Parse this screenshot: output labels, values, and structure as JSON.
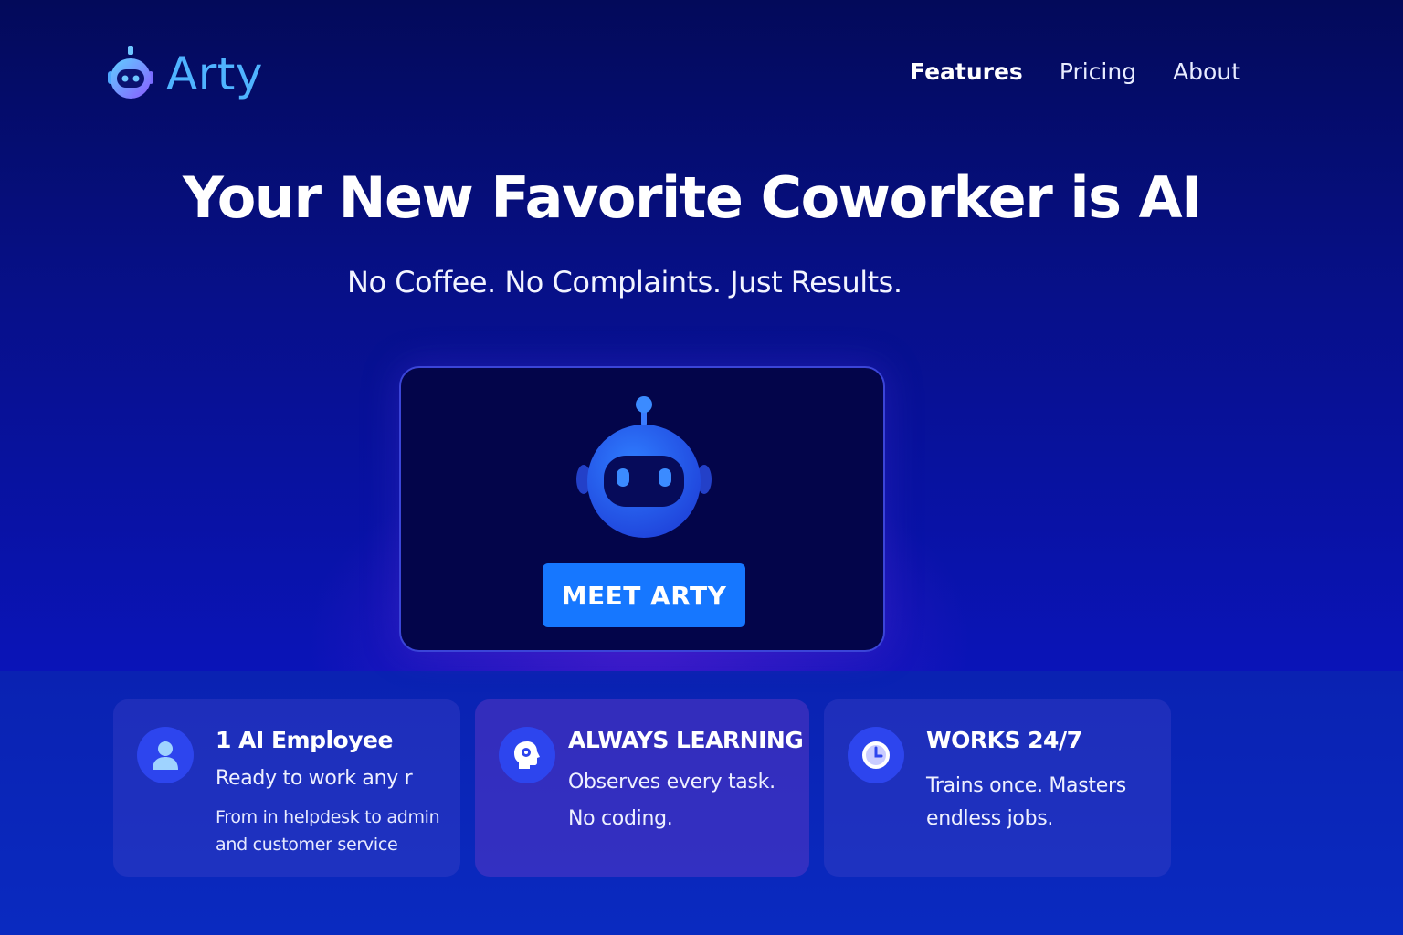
{
  "brand": {
    "name": "Arty",
    "icon": "robot-head-icon",
    "color": "#4fb3ff"
  },
  "nav": {
    "items": [
      {
        "label": "Features",
        "active": true
      },
      {
        "label": "Pricing",
        "active": false
      },
      {
        "label": "About",
        "active": false
      }
    ]
  },
  "hero": {
    "headline": "Your New Favorite Coworker is AI",
    "subheadline": "No Coffee. No Complaints. Just Results.",
    "card_icon": "robot-mascot-icon",
    "cta_label": "MEET ARTY",
    "cta_color": "#1677ff"
  },
  "features": [
    {
      "icon": "user-icon",
      "title": "1 AI Employee",
      "line1": "Ready to work any r",
      "line2": "From in helpdesk to admin",
      "line3": "and customer service"
    },
    {
      "icon": "brain-head-icon",
      "title": "ALWAYS LEARNING",
      "line1": "Observes every task.",
      "line2": "No coding."
    },
    {
      "icon": "clock-icon",
      "title": "WORKS 24/7",
      "line1": "Trains once. Masters",
      "line2": "endless jobs."
    }
  ]
}
